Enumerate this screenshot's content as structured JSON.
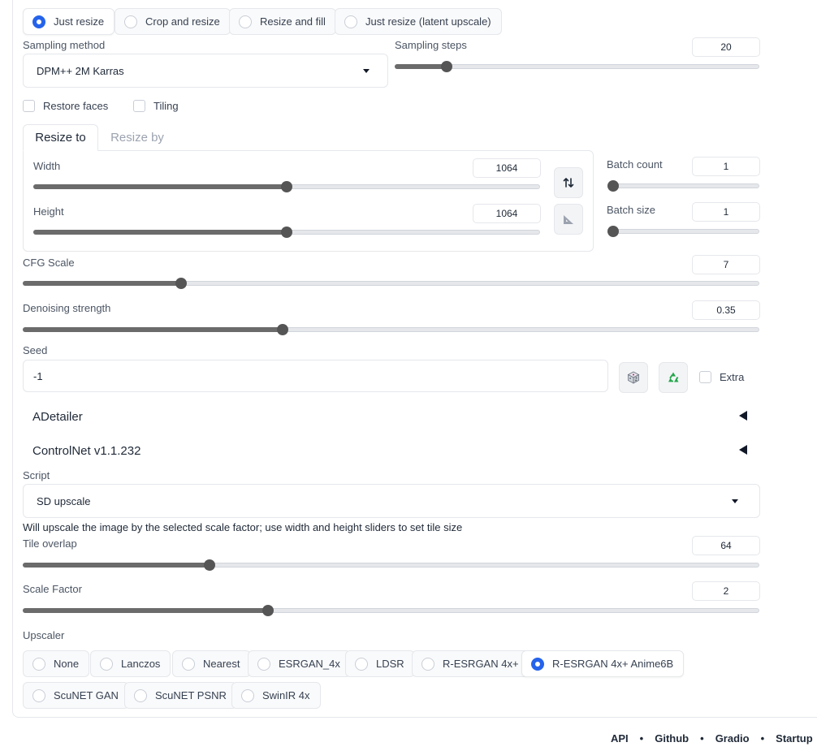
{
  "resize_mode": {
    "options": [
      "Just resize",
      "Crop and resize",
      "Resize and fill",
      "Just resize (latent upscale)"
    ],
    "selected": "Just resize"
  },
  "sampling_method": {
    "label": "Sampling method",
    "value": "DPM++ 2M Karras"
  },
  "sampling_steps": {
    "label": "Sampling steps",
    "value": "20",
    "level": 0.13
  },
  "restore_faces": {
    "label": "Restore faces",
    "checked": false
  },
  "tiling": {
    "label": "Tiling",
    "checked": false
  },
  "size_tabs": {
    "tabs": [
      "Resize to",
      "Resize by"
    ],
    "active": "Resize to"
  },
  "width": {
    "label": "Width",
    "value": "1064",
    "level": 0.5
  },
  "height": {
    "label": "Height",
    "value": "1064",
    "level": 0.5
  },
  "batch_count": {
    "label": "Batch count",
    "value": "1",
    "level": 0.0
  },
  "batch_size": {
    "label": "Batch size",
    "value": "1",
    "level": 0.0
  },
  "swap_icon": "swap-vertical-icon",
  "aspect_icon": "triangle-ruler-icon",
  "cfg_scale": {
    "label": "CFG Scale",
    "value": "7",
    "level": 0.21
  },
  "denoising": {
    "label": "Denoising strength",
    "value": "0.35",
    "level": 0.35
  },
  "seed": {
    "label": "Seed",
    "value": "-1",
    "extra_label": "Extra"
  },
  "dice_icon": "dice-icon",
  "recycle_icon": "recycle-icon",
  "accordions": [
    "ADetailer",
    "ControlNet v1.1.232"
  ],
  "script": {
    "label": "Script",
    "value": "SD upscale"
  },
  "script_info": "Will upscale the image by the selected scale factor; use width and height sliders to set tile size",
  "tile_overlap": {
    "label": "Tile overlap",
    "value": "64",
    "level": 0.25
  },
  "scale_factor": {
    "label": "Scale Factor",
    "value": "2",
    "level": 0.33
  },
  "upscaler": {
    "label": "Upscaler",
    "options": [
      "None",
      "Lanczos",
      "Nearest",
      "ESRGAN_4x",
      "LDSR",
      "R-ESRGAN 4x+",
      "R-ESRGAN 4x+ Anime6B",
      "ScuNET GAN",
      "ScuNET PSNR",
      "SwinIR 4x"
    ],
    "selected": "R-ESRGAN 4x+ Anime6B"
  },
  "footer": {
    "links": [
      "API",
      "Github",
      "Gradio",
      "Startup"
    ],
    "separator": "•"
  },
  "colors": {
    "accent": "#2563eb",
    "slider_fill": "#6b6b6b",
    "recycle": "#22a64a"
  }
}
